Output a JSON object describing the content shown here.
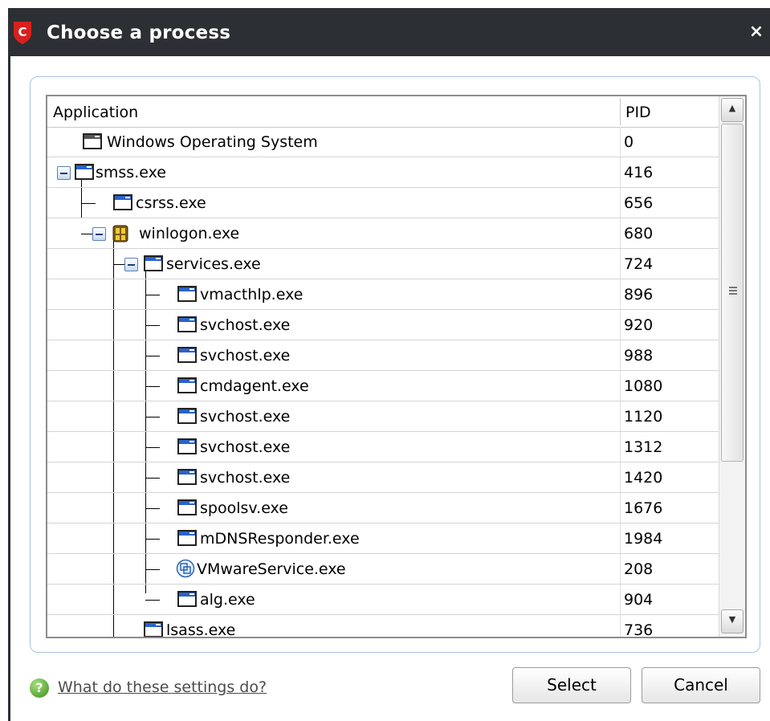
{
  "window": {
    "title": "Choose a process",
    "close_glyph": "×",
    "logo_letter": "C"
  },
  "list": {
    "columns": {
      "application": "Application",
      "pid": "PID"
    },
    "rows": [
      {
        "name": "Windows Operating System",
        "pid": "0",
        "icon": "window-icon"
      },
      {
        "name": "smss.exe",
        "pid": "416",
        "icon": "window-icon",
        "expanded": true
      },
      {
        "name": "csrss.exe",
        "pid": "656",
        "icon": "window-icon"
      },
      {
        "name": "winlogon.exe",
        "pid": "680",
        "icon": "winlogon-icon",
        "expanded": true
      },
      {
        "name": "services.exe",
        "pid": "724",
        "icon": "window-icon",
        "expanded": true
      },
      {
        "name": "vmacthlp.exe",
        "pid": "896",
        "icon": "window-icon"
      },
      {
        "name": "svchost.exe",
        "pid": "920",
        "icon": "window-icon"
      },
      {
        "name": "svchost.exe",
        "pid": "988",
        "icon": "window-icon"
      },
      {
        "name": "cmdagent.exe",
        "pid": "1080",
        "icon": "window-icon"
      },
      {
        "name": "svchost.exe",
        "pid": "1120",
        "icon": "window-icon"
      },
      {
        "name": "svchost.exe",
        "pid": "1312",
        "icon": "window-icon"
      },
      {
        "name": "svchost.exe",
        "pid": "1420",
        "icon": "window-icon"
      },
      {
        "name": "spoolsv.exe",
        "pid": "1676",
        "icon": "window-icon"
      },
      {
        "name": "mDNSResponder.exe",
        "pid": "1984",
        "icon": "window-icon"
      },
      {
        "name": "VMwareService.exe",
        "pid": "208",
        "icon": "vmware-icon"
      },
      {
        "name": "alg.exe",
        "pid": "904",
        "icon": "window-icon"
      },
      {
        "name": "lsass.exe",
        "pid": "736",
        "icon": "window-icon"
      }
    ]
  },
  "footer": {
    "help_link": "What do these settings do?",
    "select_label": "Select",
    "cancel_label": "Cancel"
  }
}
